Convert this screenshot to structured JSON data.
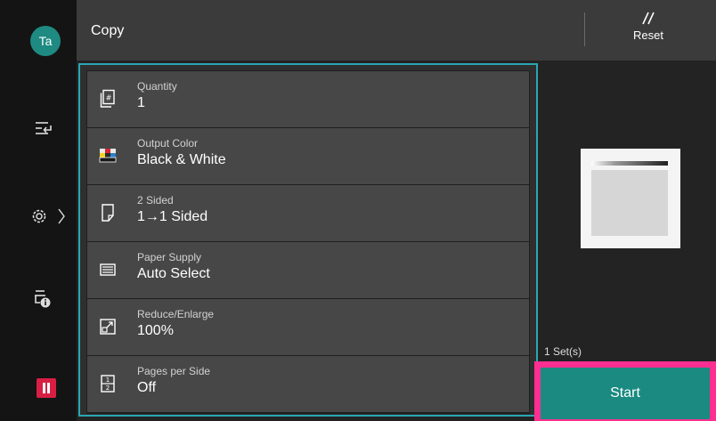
{
  "user": {
    "initials": "Ta"
  },
  "header": {
    "title": "Copy",
    "reset_label": "Reset"
  },
  "features": [
    {
      "label": "Quantity",
      "value": "1",
      "icon": "quantity-icon"
    },
    {
      "label": "Output Color",
      "value": "Black & White",
      "icon": "output-color-icon"
    },
    {
      "label": "2 Sided",
      "value": "1→1 Sided",
      "icon": "two-sided-icon"
    },
    {
      "label": "Paper Supply",
      "value": "Auto Select",
      "icon": "paper-tray-icon"
    },
    {
      "label": "Reduce/Enlarge",
      "value": "100%",
      "icon": "reduce-enlarge-icon"
    },
    {
      "label": "Pages per Side",
      "value": "Off",
      "icon": "pages-per-side-icon"
    }
  ],
  "status": {
    "sets": "1 Set(s)"
  },
  "actions": {
    "start_label": "Start"
  },
  "colors": {
    "accent_teal": "#1b8a81",
    "panel_border": "#2aa5b2",
    "highlight_pink": "#ff2f92",
    "pause_red": "#d81f43"
  }
}
